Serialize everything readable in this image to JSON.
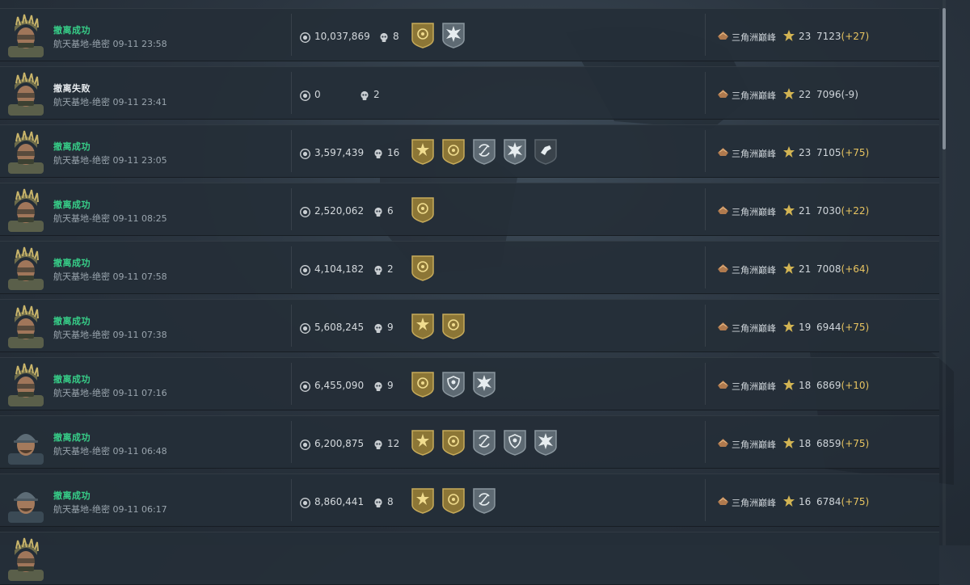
{
  "records": [
    {
      "status": "撤离成功",
      "ok": true,
      "map": "航天基地-绝密",
      "time": "09-11 23:58",
      "value": "10,037,869",
      "kills": "8",
      "avatar": "helmet",
      "badges": [
        "gold-target",
        "silver-burst"
      ],
      "rank": "三角洲巅峰",
      "level": "23",
      "points": "7123",
      "delta": "(+27)",
      "delta_sign": "pos"
    },
    {
      "status": "撤离失败",
      "ok": false,
      "map": "航天基地-绝密",
      "time": "09-11 23:41",
      "value": "0",
      "kills": "2",
      "avatar": "helmet",
      "badges": [],
      "rank": "三角洲巅峰",
      "level": "22",
      "points": "7096",
      "delta": "(-9)",
      "delta_sign": "neg"
    },
    {
      "status": "撤离成功",
      "ok": true,
      "map": "航天基地-绝密",
      "time": "09-11 23:05",
      "value": "3,597,439",
      "kills": "16",
      "avatar": "helmet",
      "badges": [
        "gold-sun",
        "gold-target",
        "silver-arrows",
        "silver-burst",
        "dark-hand"
      ],
      "rank": "三角洲巅峰",
      "level": "23",
      "points": "7105",
      "delta": "(+75)",
      "delta_sign": "pos"
    },
    {
      "status": "撤离成功",
      "ok": true,
      "map": "航天基地-绝密",
      "time": "09-11 08:25",
      "value": "2,520,062",
      "kills": "6",
      "avatar": "helmet",
      "badges": [
        "gold-target"
      ],
      "rank": "三角洲巅峰",
      "level": "21",
      "points": "7030",
      "delta": "(+22)",
      "delta_sign": "pos"
    },
    {
      "status": "撤离成功",
      "ok": true,
      "map": "航天基地-绝密",
      "time": "09-11 07:58",
      "value": "4,104,182",
      "kills": "2",
      "avatar": "helmet",
      "badges": [
        "gold-target"
      ],
      "rank": "三角洲巅峰",
      "level": "21",
      "points": "7008",
      "delta": "(+64)",
      "delta_sign": "pos"
    },
    {
      "status": "撤离成功",
      "ok": true,
      "map": "航天基地-绝密",
      "time": "09-11 07:38",
      "value": "5,608,245",
      "kills": "9",
      "avatar": "helmet",
      "badges": [
        "gold-sun",
        "gold-target"
      ],
      "rank": "三角洲巅峰",
      "level": "19",
      "points": "6944",
      "delta": "(+75)",
      "delta_sign": "pos"
    },
    {
      "status": "撤离成功",
      "ok": true,
      "map": "航天基地-绝密",
      "time": "09-11 07:16",
      "value": "6,455,090",
      "kills": "9",
      "avatar": "helmet",
      "badges": [
        "gold-target",
        "silver-shield",
        "silver-burst"
      ],
      "rank": "三角洲巅峰",
      "level": "18",
      "points": "6869",
      "delta": "(+10)",
      "delta_sign": "pos"
    },
    {
      "status": "撤离成功",
      "ok": true,
      "map": "航天基地-绝密",
      "time": "09-11 06:48",
      "value": "6,200,875",
      "kills": "12",
      "avatar": "cap",
      "badges": [
        "gold-sun",
        "gold-target",
        "silver-arrows",
        "silver-shield",
        "silver-burst"
      ],
      "rank": "三角洲巅峰",
      "level": "18",
      "points": "6859",
      "delta": "(+75)",
      "delta_sign": "pos"
    },
    {
      "status": "撤离成功",
      "ok": true,
      "map": "航天基地-绝密",
      "time": "09-11 06:17",
      "value": "8,860,441",
      "kills": "8",
      "avatar": "cap",
      "badges": [
        "gold-sun",
        "gold-target",
        "silver-arrows"
      ],
      "rank": "三角洲巅峰",
      "level": "16",
      "points": "6784",
      "delta": "(+75)",
      "delta_sign": "pos"
    }
  ],
  "colors": {
    "success": "#37d089",
    "fail": "#e8ecef",
    "delta_positive": "#e8c460",
    "gold_badge": "#b79a4a",
    "silver_badge": "#6e7a84"
  }
}
